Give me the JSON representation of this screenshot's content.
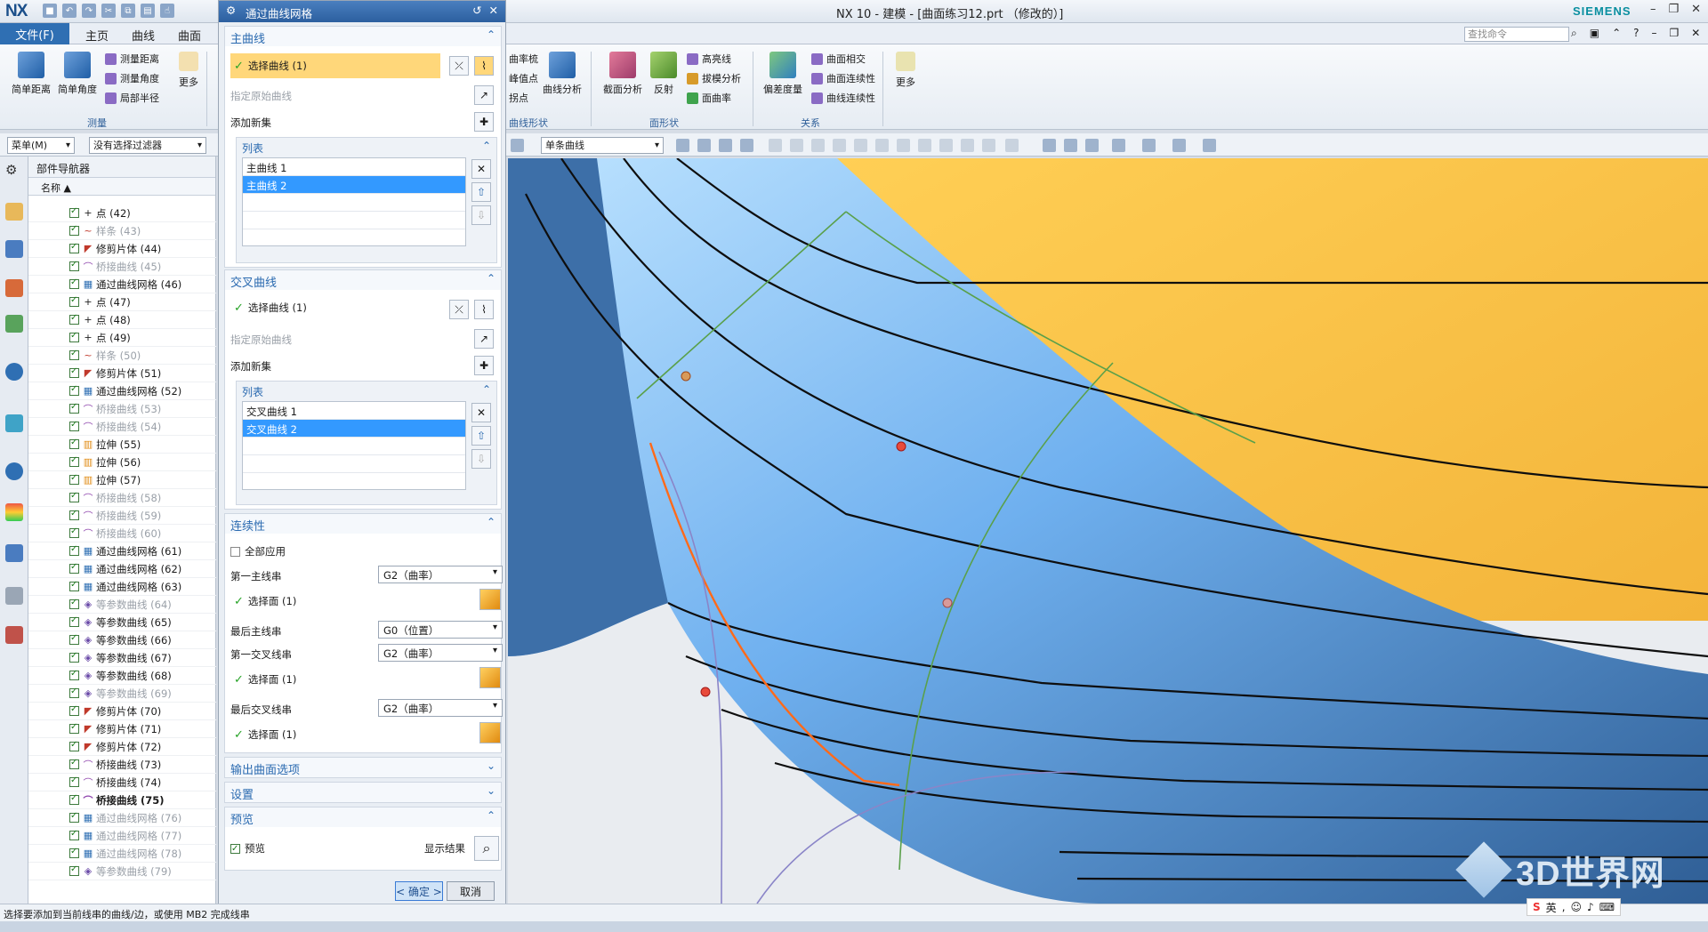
{
  "window": {
    "app": "NX",
    "title": "NX 10 - 建模 - [曲面练习12.prt （修改的）]",
    "brand": "SIEMENS"
  },
  "ribbon_tabs": [
    "文件(F)",
    "主页",
    "曲线",
    "曲面"
  ],
  "command_search": "查找命令",
  "ribbon": {
    "measure_group": "测量",
    "simple_distance": "简单距离",
    "simple_angle": "简单角度",
    "measure_distance": "测量距离",
    "measure_angle": "测量角度",
    "local_radius": "局部半径",
    "more": "更多",
    "curvature_comb": "曲率梳",
    "peak_point": "峰值点",
    "inflection": "拐点",
    "curve_analysis": "曲线分析",
    "curve_shape_group": "曲线形状",
    "section_analysis": "截面分析",
    "reflection": "反射",
    "highlight": "高亮线",
    "draft_analysis": "拔模分析",
    "surface_curvature": "面曲率",
    "face_shape_group": "面形状",
    "deviation": "偏差度量",
    "face_intersect": "曲面相交",
    "face_continuity": "曲面连续性",
    "curve_continuity": "曲线连续性",
    "relation_group": "关系",
    "more2": "更多"
  },
  "toolbar": {
    "menu": "菜单(M)",
    "filter": "没有选择过滤器",
    "curve_rule": "单条曲线"
  },
  "navigator": {
    "title": "部件导航器",
    "col_name": "名称",
    "items": [
      {
        "label": "点 (42)",
        "icon": "point-icon",
        "dim": false,
        "bold": false
      },
      {
        "label": "样条 (43)",
        "icon": "spline-icon",
        "dim": true,
        "bold": false
      },
      {
        "label": "修剪片体 (44)",
        "icon": "trim-sheet-icon",
        "dim": false,
        "bold": false
      },
      {
        "label": "桥接曲线 (45)",
        "icon": "bridge-curve-icon",
        "dim": true,
        "bold": false
      },
      {
        "label": "通过曲线网格 (46)",
        "icon": "through-curve-mesh-icon",
        "dim": false,
        "bold": false
      },
      {
        "label": "点 (47)",
        "icon": "point-icon",
        "dim": false,
        "bold": false
      },
      {
        "label": "点 (48)",
        "icon": "point-icon",
        "dim": false,
        "bold": false
      },
      {
        "label": "点 (49)",
        "icon": "point-icon",
        "dim": false,
        "bold": false
      },
      {
        "label": "样条 (50)",
        "icon": "spline-icon",
        "dim": true,
        "bold": false
      },
      {
        "label": "修剪片体 (51)",
        "icon": "trim-sheet-icon",
        "dim": false,
        "bold": false
      },
      {
        "label": "通过曲线网格 (52)",
        "icon": "through-curve-mesh-icon",
        "dim": false,
        "bold": false
      },
      {
        "label": "桥接曲线 (53)",
        "icon": "bridge-curve-icon",
        "dim": true,
        "bold": false
      },
      {
        "label": "桥接曲线 (54)",
        "icon": "bridge-curve-icon",
        "dim": true,
        "bold": false
      },
      {
        "label": "拉伸 (55)",
        "icon": "extrude-icon",
        "dim": false,
        "bold": false
      },
      {
        "label": "拉伸 (56)",
        "icon": "extrude-icon",
        "dim": false,
        "bold": false
      },
      {
        "label": "拉伸 (57)",
        "icon": "extrude-icon",
        "dim": false,
        "bold": false
      },
      {
        "label": "桥接曲线 (58)",
        "icon": "bridge-curve-icon",
        "dim": true,
        "bold": false
      },
      {
        "label": "桥接曲线 (59)",
        "icon": "bridge-curve-icon",
        "dim": true,
        "bold": false
      },
      {
        "label": "桥接曲线 (60)",
        "icon": "bridge-curve-icon",
        "dim": true,
        "bold": false
      },
      {
        "label": "通过曲线网格 (61)",
        "icon": "through-curve-mesh-icon",
        "dim": false,
        "bold": false
      },
      {
        "label": "通过曲线网格 (62)",
        "icon": "through-curve-mesh-icon",
        "dim": false,
        "bold": false
      },
      {
        "label": "通过曲线网格 (63)",
        "icon": "through-curve-mesh-icon",
        "dim": false,
        "bold": false
      },
      {
        "label": "等参数曲线 (64)",
        "icon": "isoparametric-icon",
        "dim": true,
        "bold": false
      },
      {
        "label": "等参数曲线 (65)",
        "icon": "isoparametric-icon",
        "dim": false,
        "bold": false
      },
      {
        "label": "等参数曲线 (66)",
        "icon": "isoparametric-icon",
        "dim": false,
        "bold": false
      },
      {
        "label": "等参数曲线 (67)",
        "icon": "isoparametric-icon",
        "dim": false,
        "bold": false
      },
      {
        "label": "等参数曲线 (68)",
        "icon": "isoparametric-icon",
        "dim": false,
        "bold": false
      },
      {
        "label": "等参数曲线 (69)",
        "icon": "isoparametric-icon",
        "dim": true,
        "bold": false
      },
      {
        "label": "修剪片体 (70)",
        "icon": "trim-sheet-icon",
        "dim": false,
        "bold": false
      },
      {
        "label": "修剪片体 (71)",
        "icon": "trim-sheet-icon",
        "dim": false,
        "bold": false
      },
      {
        "label": "修剪片体 (72)",
        "icon": "trim-sheet-icon",
        "dim": false,
        "bold": false
      },
      {
        "label": "桥接曲线 (73)",
        "icon": "bridge-curve-icon",
        "dim": false,
        "bold": false
      },
      {
        "label": "桥接曲线 (74)",
        "icon": "bridge-curve-icon",
        "dim": false,
        "bold": false
      },
      {
        "label": "桥接曲线 (75)",
        "icon": "bridge-curve-icon",
        "dim": false,
        "bold": true
      },
      {
        "label": "通过曲线网格 (76)",
        "icon": "through-curve-mesh-icon",
        "dim": true,
        "bold": false
      },
      {
        "label": "通过曲线网格 (77)",
        "icon": "through-curve-mesh-icon",
        "dim": true,
        "bold": false
      },
      {
        "label": "通过曲线网格 (78)",
        "icon": "through-curve-mesh-icon",
        "dim": true,
        "bold": false
      },
      {
        "label": "等参数曲线 (79)",
        "icon": "isoparametric-icon",
        "dim": true,
        "bold": false
      }
    ]
  },
  "dialog": {
    "title": "通过曲线网格",
    "primary": {
      "header": "主曲线",
      "select": "选择曲线 (1)",
      "specify_origin": "指定原始曲线",
      "add_new": "添加新集",
      "list_header": "列表",
      "rows": [
        "主曲线 1",
        "主曲线 2"
      ]
    },
    "cross": {
      "header": "交叉曲线",
      "select": "选择曲线 (1)",
      "specify_origin": "指定原始曲线",
      "add_new": "添加新集",
      "list_header": "列表",
      "rows": [
        "交叉曲线 1",
        "交叉曲线 2"
      ]
    },
    "continuity": {
      "header": "连续性",
      "apply_all": "全部应用",
      "first_primary": "第一主线串",
      "first_primary_val": "G2（曲率）",
      "select_face1": "选择面 (1)",
      "last_primary": "最后主线串",
      "last_primary_val": "G0（位置）",
      "first_cross": "第一交叉线串",
      "first_cross_val": "G2（曲率）",
      "select_face2": "选择面 (1)",
      "last_cross": "最后交叉线串",
      "last_cross_val": "G2（曲率）",
      "select_face3": "选择面 (1)"
    },
    "output_options": "输出曲面选项",
    "settings": "设置",
    "preview": {
      "header": "预览",
      "label": "预览",
      "show_result": "显示结果"
    },
    "ok": "< 确定 >",
    "cancel": "取消"
  },
  "status": "选择要添加到当前线串的曲线/边，或使用 MB2 完成线串",
  "watermark": "3D世界网",
  "ime": {
    "lang": "英"
  },
  "colors": {
    "accent": "#2f6fb3",
    "surface_blue": "#7ab8f5",
    "surface_orange": "#f5b83c",
    "highlight": "#ffd77a"
  }
}
